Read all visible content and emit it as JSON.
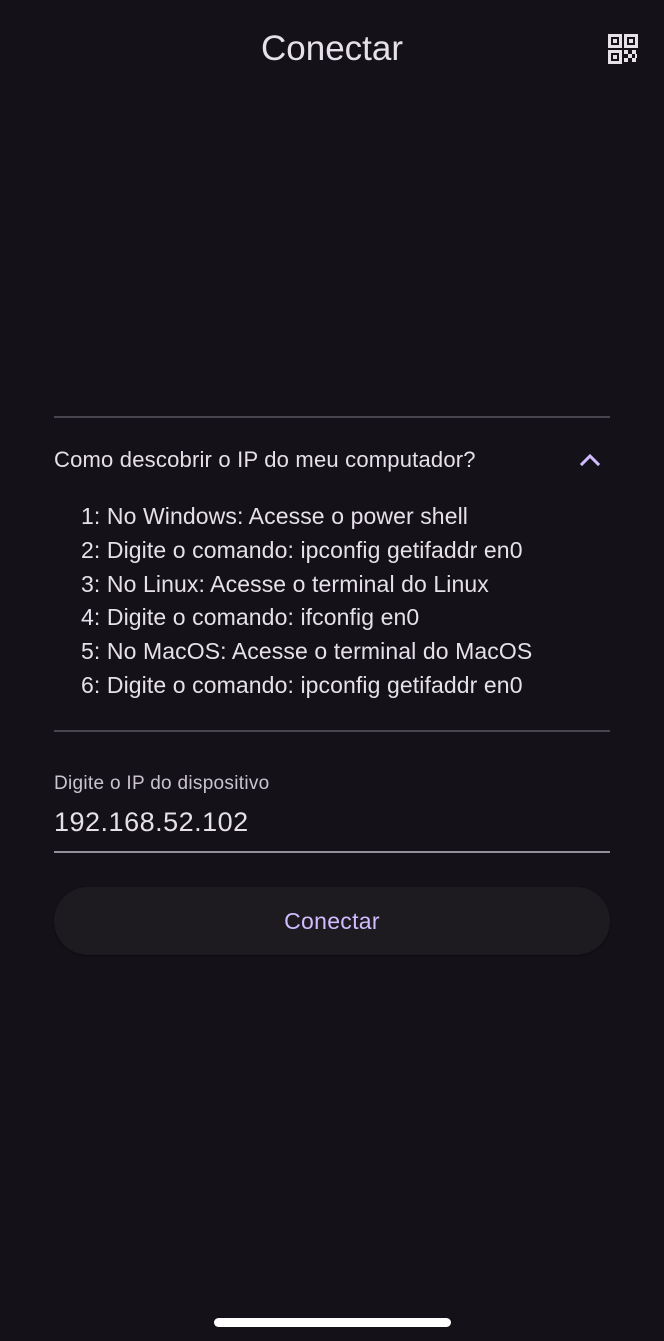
{
  "app_bar": {
    "title": "Conectar",
    "qr_icon": "qr-code-scanner-icon"
  },
  "help": {
    "title": "Como descobrir o IP do meu computador?",
    "expanded": true,
    "chevron_icon": "chevron-up-icon",
    "steps": [
      "1: No Windows: Acesse o power shell",
      "2: Digite o comando: ipconfig getifaddr en0",
      "3: No Linux: Acesse o terminal do Linux",
      "4: Digite o comando: ifconfig en0",
      "5: No MacOS: Acesse o terminal do MacOS",
      "6: Digite o comando: ipconfig getifaddr en0"
    ]
  },
  "ip_field": {
    "label": "Digite o IP do dispositivo",
    "value": "192.168.52.102"
  },
  "connect_button": {
    "label": "Conectar"
  },
  "colors": {
    "background": "#141218",
    "accent": "#d0bcff",
    "text": "#e6e0e9"
  }
}
